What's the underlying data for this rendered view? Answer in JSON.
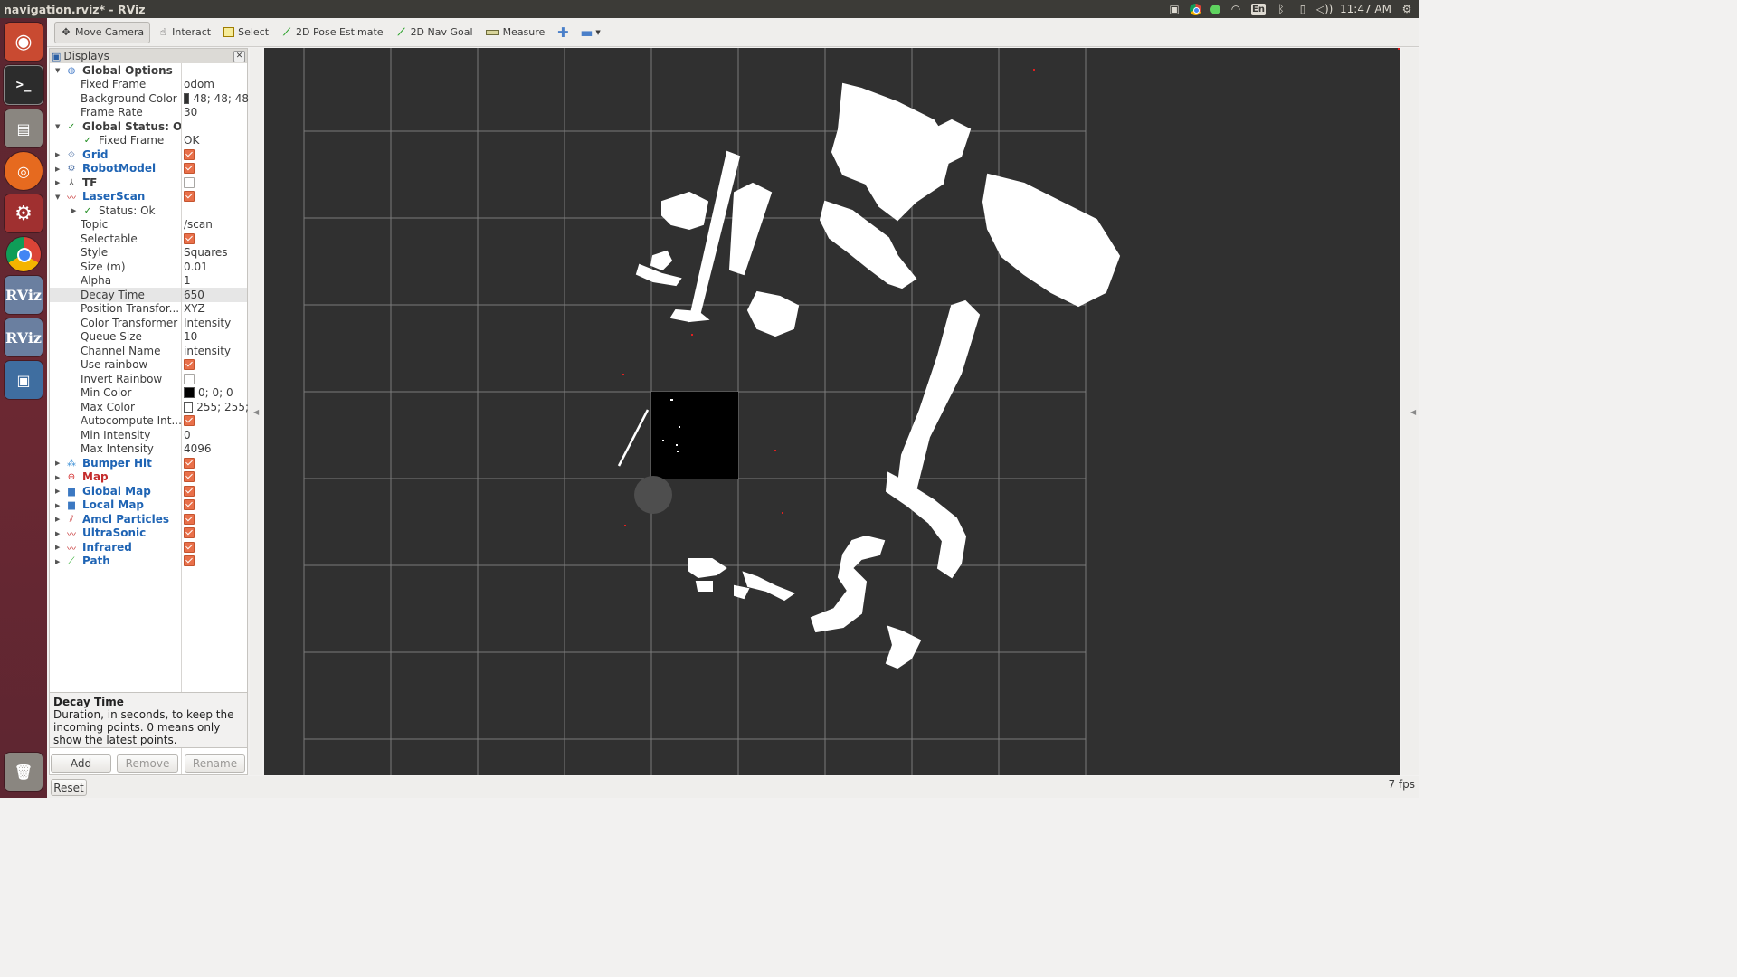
{
  "window": {
    "title": "navigation.rviz* - RViz"
  },
  "tray": {
    "time": "11:47 AM",
    "lang": "En"
  },
  "launcher": {
    "items": [
      {
        "name": "ubuntu-dash-icon",
        "glyph": "◉"
      },
      {
        "name": "terminal-icon",
        "glyph": ">_"
      },
      {
        "name": "files-icon",
        "glyph": "▤"
      },
      {
        "name": "firefox-icon",
        "glyph": "◎"
      },
      {
        "name": "system-settings-icon",
        "glyph": "⚙"
      },
      {
        "name": "chrome-icon",
        "glyph": ""
      },
      {
        "name": "rviz-icon",
        "glyph": "RViz"
      },
      {
        "name": "rviz-icon-2",
        "glyph": "RViz"
      },
      {
        "name": "remote-desktop-icon",
        "glyph": "▣"
      }
    ],
    "trash_glyph": "🗑"
  },
  "toolbar": {
    "move_camera": "Move Camera",
    "interact": "Interact",
    "select": "Select",
    "pose_estimate": "2D Pose Estimate",
    "nav_goal": "2D Nav Goal",
    "measure": "Measure"
  },
  "panel": {
    "title": "Displays",
    "rows": [
      {
        "indent": 0,
        "arrow": "▼",
        "icon": "globe",
        "name": "Global Options",
        "val": "",
        "style": ""
      },
      {
        "indent": 1,
        "arrow": "",
        "icon": "",
        "name": "Fixed Frame",
        "val": "odom",
        "style": ""
      },
      {
        "indent": 1,
        "arrow": "",
        "icon": "",
        "name": "Background Color",
        "val": "48; 48; 48",
        "swatch": "#303030",
        "style": ""
      },
      {
        "indent": 1,
        "arrow": "",
        "icon": "",
        "name": "Frame Rate",
        "val": "30",
        "style": ""
      },
      {
        "indent": 0,
        "arrow": "▼",
        "icon": "check",
        "name": "Global Status: Ok",
        "val": "",
        "style": ""
      },
      {
        "indent": 1,
        "arrow": "",
        "icon": "check",
        "name": "Fixed Frame",
        "val": "OK",
        "style": ""
      },
      {
        "indent": 0,
        "arrow": "▶",
        "icon": "grid",
        "name": "Grid",
        "val": "",
        "cb": true,
        "style": "blue"
      },
      {
        "indent": 0,
        "arrow": "▶",
        "icon": "robot",
        "name": "RobotModel",
        "val": "",
        "cb": true,
        "style": "blue"
      },
      {
        "indent": 0,
        "arrow": "▶",
        "icon": "tf",
        "name": "TF",
        "val": "",
        "cb": false,
        "style": "bold"
      },
      {
        "indent": 0,
        "arrow": "▼",
        "icon": "laser",
        "name": "LaserScan",
        "val": "",
        "cb": true,
        "style": "blue"
      },
      {
        "indent": 1,
        "arrow": "▶",
        "icon": "check",
        "name": "Status: Ok",
        "val": "",
        "style": ""
      },
      {
        "indent": 1,
        "arrow": "",
        "icon": "",
        "name": "Topic",
        "val": "/scan",
        "style": ""
      },
      {
        "indent": 1,
        "arrow": "",
        "icon": "",
        "name": "Selectable",
        "val": "",
        "cb": true,
        "style": ""
      },
      {
        "indent": 1,
        "arrow": "",
        "icon": "",
        "name": "Style",
        "val": "Squares",
        "style": ""
      },
      {
        "indent": 1,
        "arrow": "",
        "icon": "",
        "name": "Size (m)",
        "val": "0.01",
        "style": ""
      },
      {
        "indent": 1,
        "arrow": "",
        "icon": "",
        "name": "Alpha",
        "val": "1",
        "style": ""
      },
      {
        "indent": 1,
        "arrow": "",
        "icon": "",
        "name": "Decay Time",
        "val": "650",
        "style": "",
        "selected": true
      },
      {
        "indent": 1,
        "arrow": "",
        "icon": "",
        "name": "Position Transfor...",
        "val": "XYZ",
        "style": ""
      },
      {
        "indent": 1,
        "arrow": "",
        "icon": "",
        "name": "Color Transformer",
        "val": "Intensity",
        "style": ""
      },
      {
        "indent": 1,
        "arrow": "",
        "icon": "",
        "name": "Queue Size",
        "val": "10",
        "style": ""
      },
      {
        "indent": 1,
        "arrow": "",
        "icon": "",
        "name": "Channel Name",
        "val": "intensity",
        "style": ""
      },
      {
        "indent": 1,
        "arrow": "",
        "icon": "",
        "name": "Use rainbow",
        "val": "",
        "cb": true,
        "style": ""
      },
      {
        "indent": 1,
        "arrow": "",
        "icon": "",
        "name": "Invert Rainbow",
        "val": "",
        "cb": false,
        "style": ""
      },
      {
        "indent": 1,
        "arrow": "",
        "icon": "",
        "name": "Min Color",
        "val": "0; 0; 0",
        "swatch": "#000000",
        "style": ""
      },
      {
        "indent": 1,
        "arrow": "",
        "icon": "",
        "name": "Max Color",
        "val": "255; 255;",
        "swatch": "#ffffff",
        "style": ""
      },
      {
        "indent": 1,
        "arrow": "",
        "icon": "",
        "name": "Autocompute Int...",
        "val": "",
        "cb": true,
        "style": ""
      },
      {
        "indent": 1,
        "arrow": "",
        "icon": "",
        "name": "Min Intensity",
        "val": "0",
        "style": ""
      },
      {
        "indent": 1,
        "arrow": "",
        "icon": "",
        "name": "Max Intensity",
        "val": "4096",
        "style": ""
      },
      {
        "indent": 0,
        "arrow": "▶",
        "icon": "bumper",
        "name": "Bumper Hit",
        "val": "",
        "cb": true,
        "style": "blue"
      },
      {
        "indent": 0,
        "arrow": "▶",
        "icon": "error",
        "name": "Map",
        "val": "",
        "cb": true,
        "style": "red"
      },
      {
        "indent": 0,
        "arrow": "▶",
        "icon": "folder",
        "name": "Global Map",
        "val": "",
        "cb": true,
        "style": "blue"
      },
      {
        "indent": 0,
        "arrow": "▶",
        "icon": "folder",
        "name": "Local Map",
        "val": "",
        "cb": true,
        "style": "blue"
      },
      {
        "indent": 0,
        "arrow": "▶",
        "icon": "particles",
        "name": "Amcl Particles",
        "val": "",
        "cb": true,
        "style": "blue"
      },
      {
        "indent": 0,
        "arrow": "▶",
        "icon": "laser",
        "name": "UltraSonic",
        "val": "",
        "cb": true,
        "style": "blue"
      },
      {
        "indent": 0,
        "arrow": "▶",
        "icon": "laser",
        "name": "Infrared",
        "val": "",
        "cb": true,
        "style": "blue"
      },
      {
        "indent": 0,
        "arrow": "▶",
        "icon": "path",
        "name": "Path",
        "val": "",
        "cb": true,
        "style": "blue"
      }
    ]
  },
  "help": {
    "title": "Decay Time",
    "text": "Duration, in seconds, to keep the incoming points. 0 means only show the latest points."
  },
  "buttons": {
    "add": "Add",
    "remove": "Remove",
    "rename": "Rename",
    "reset": "Reset"
  },
  "status": {
    "fps": "7 fps"
  },
  "colors": {
    "viewport_bg": "#303030",
    "grid": "#7a7a7a",
    "points": "#ffffff"
  }
}
